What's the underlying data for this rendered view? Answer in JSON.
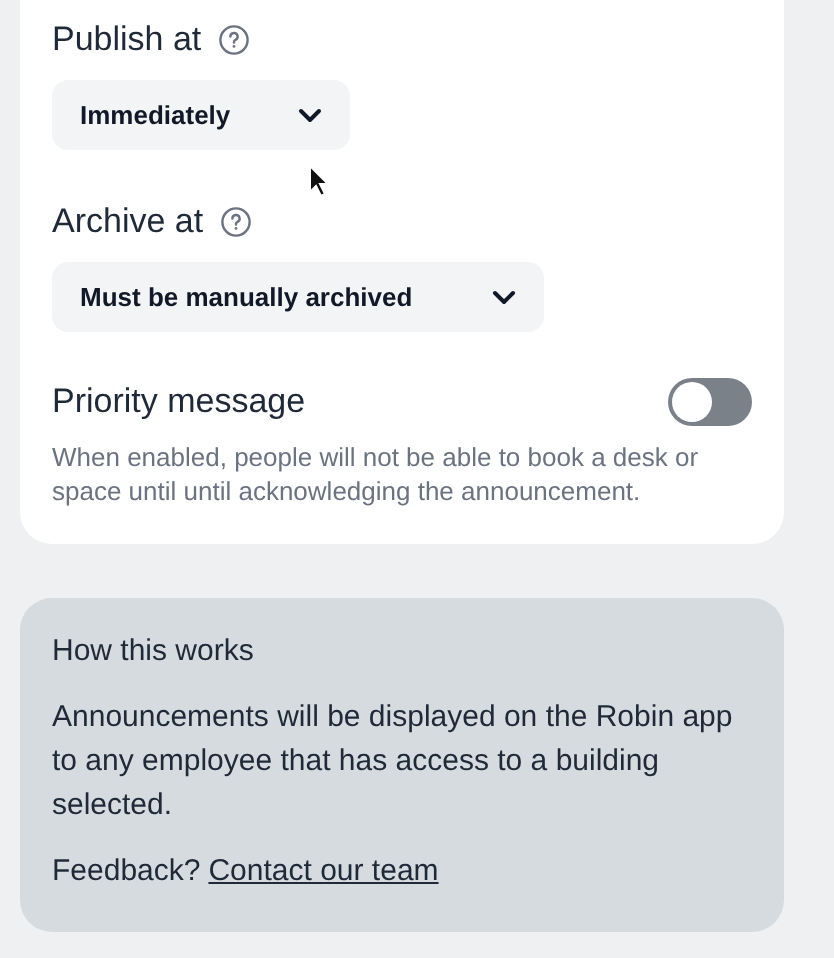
{
  "schedule": [
    {
      "label": "Publish at",
      "value": "Immediately"
    },
    {
      "label": "Archive at",
      "value": "Must be manually archived"
    }
  ],
  "priority": {
    "label": "Priority message",
    "on": false,
    "description": "When enabled, people will not be able to book a desk or space until until acknowledging the announcement."
  },
  "info": {
    "title": "How this works",
    "body": "Announcements will be displayed on the Robin app to any employee that has access to a building selected.",
    "feedback_label": "Feedback?",
    "link": "Contact our team"
  }
}
